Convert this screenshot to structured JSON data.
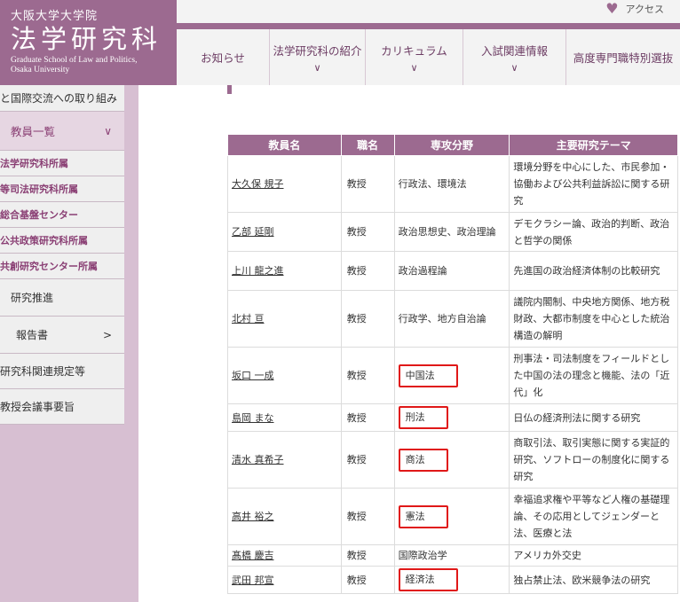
{
  "header": {
    "university": "大阪大学大学院",
    "school_name": "法学研究科",
    "school_english_line1": "Graduate School of Law and Politics,",
    "school_english_line2": "Osaka University",
    "access_label": "アクセス"
  },
  "nav": [
    {
      "label": "お知らせ",
      "has_dropdown": false
    },
    {
      "label": "法学研究科の紹介",
      "has_dropdown": true
    },
    {
      "label": "カリキュラム",
      "has_dropdown": true
    },
    {
      "label": "入試関連情報",
      "has_dropdown": true
    },
    {
      "label": "高度専門職特別選抜",
      "label_line2": "抜",
      "has_dropdown": false
    }
  ],
  "sidebar": {
    "international": "と国際交流への取り組み",
    "faculty_list": "教員一覧",
    "sub_items": [
      "法学研究科所属",
      "等司法研究科所属",
      "総合基盤センター",
      "公共政策研究科所属",
      "共創研究センター所属"
    ],
    "research": "研究推進",
    "reports": "報告書",
    "regulations": "研究科関連規定等",
    "minutes": "教授会議事要旨"
  },
  "table": {
    "headers": [
      "教員名",
      "職名",
      "専攻分野",
      "主要研究テーマ"
    ],
    "rows": [
      {
        "name": "大久保 規子",
        "position": "教授",
        "field": "行政法、環境法",
        "theme": "環境分野を中心にした、市民参加・協働および公共利益訴訟に関する研究",
        "highlighted": false
      },
      {
        "name": "乙部 延剛",
        "position": "教授",
        "field": "政治思想史、政治理論",
        "theme": "デモクラシー論、政治的判断、政治と哲学の関係",
        "highlighted": false
      },
      {
        "name": "上川 龍之進",
        "position": "教授",
        "field": "政治過程論",
        "theme": "先進国の政治経済体制の比較研究",
        "highlighted": false
      },
      {
        "name": "北村 亘",
        "position": "教授",
        "field": "行政学、地方自治論",
        "theme": "議院内閣制、中央地方関係、地方税財政、大都市制度を中心とした統治構造の解明",
        "highlighted": false
      },
      {
        "name": "坂口 一成",
        "position": "教授",
        "field": "中国法",
        "theme": "刑事法・司法制度をフィールドとした中国の法の理念と機能、法の「近代」化",
        "highlighted": true
      },
      {
        "name": "島岡 まな",
        "position": "教授",
        "field": "刑法",
        "theme": "日仏の経済刑法に関する研究",
        "highlighted": true
      },
      {
        "name": "清水 真希子",
        "position": "教授",
        "field": "商法",
        "theme": "商取引法、取引実態に関する実証的研究、ソフトローの制度化に関する研究",
        "highlighted": true
      },
      {
        "name": "高井 裕之",
        "position": "教授",
        "field": "憲法",
        "theme": "幸福追求権や平等など人権の基礎理論、その応用としてジェンダーと法、医療と法",
        "highlighted": true
      },
      {
        "name": "髙橋 慶吉",
        "position": "教授",
        "field": "国際政治学",
        "theme": "アメリカ外交史",
        "highlighted": false
      },
      {
        "name": "武田 邦宣",
        "position": "教授",
        "field": "経済法",
        "theme": "独占禁止法、欧米競争法の研究",
        "highlighted": true
      }
    ]
  },
  "colors": {
    "brand": "#9c6a90",
    "sidebar_bg": "#d7bfd2",
    "highlight_box": "#e01818"
  }
}
